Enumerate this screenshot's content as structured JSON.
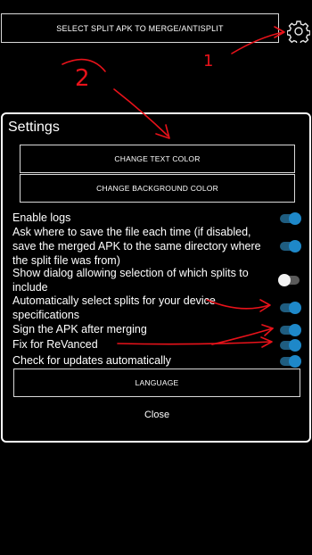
{
  "top_button": {
    "label": "SELECT SPLIT APK TO MERGE/ANTISPLIT"
  },
  "gear": {
    "icon": "gear-icon"
  },
  "dialog": {
    "title": "Settings",
    "change_text_color": "CHANGE TEXT COLOR",
    "change_background_color": "CHANGE BACKGROUND COLOR",
    "settings": [
      {
        "label": "Enable logs",
        "on": true
      },
      {
        "label": "Ask where to save the file each time (if disabled, save the merged APK to the same directory where the split file was from)",
        "on": true
      },
      {
        "label": "Show dialog allowing selection of which splits to include",
        "on": false
      },
      {
        "label": "Automatically select splits for your device specifications",
        "on": true
      },
      {
        "label": "Sign the APK after merging",
        "on": true
      },
      {
        "label": "Fix for ReVanced",
        "on": true
      },
      {
        "label": "Check for updates automatically",
        "on": true
      }
    ],
    "language": "LANGUAGE",
    "close": "Close"
  },
  "annotations": {
    "labels": [
      "1",
      "2"
    ],
    "color": "#e8121a"
  },
  "colors": {
    "background": "#000000",
    "toggle_on": "#1e88c9",
    "toggle_off_thumb": "#f2f2f2"
  }
}
